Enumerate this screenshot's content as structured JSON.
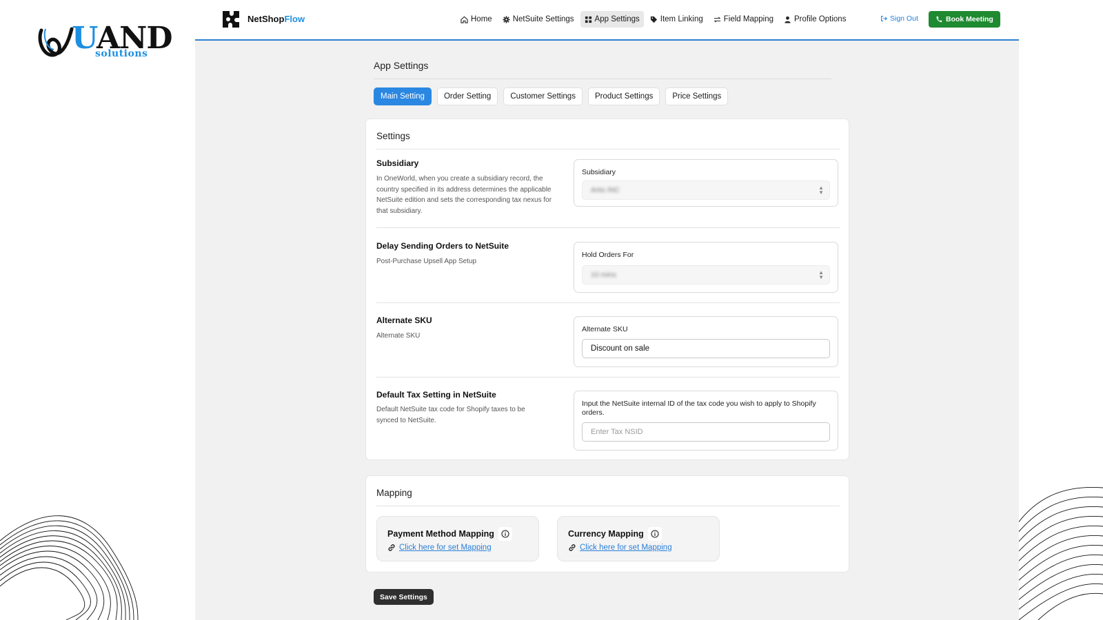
{
  "brand": {
    "name_main": "AND",
    "name_u": "U",
    "sub": "solutions"
  },
  "app": {
    "logo": {
      "name_a": "NetShop",
      "name_b": "Flow"
    },
    "nav": [
      {
        "label": "Home",
        "icon": "home-icon"
      },
      {
        "label": "NetSuite Settings",
        "icon": "gear-icon"
      },
      {
        "label": "App Settings",
        "icon": "grid-icon",
        "active": true
      },
      {
        "label": "Item Linking",
        "icon": "tag-icon"
      },
      {
        "label": "Field Mapping",
        "icon": "arrows-icon"
      },
      {
        "label": "Profile Options",
        "icon": "user-icon"
      }
    ],
    "signout": "Sign Out",
    "book": "Book Meeting"
  },
  "page": {
    "title": "App Settings",
    "tabs": [
      "Main Setting",
      "Order Setting",
      "Customer Settings",
      "Product Settings",
      "Price Settings"
    ],
    "active_tab": "Main Setting"
  },
  "settings": {
    "title": "Settings",
    "subsidiary": {
      "label": "Subsidiary",
      "desc": "In OneWorld, when you create a subsidiary record, the country specified in its address determines the applicable NetSuite edition and sets the corresponding tax nexus for that subsidiary.",
      "field_label": "Subsidiary",
      "value": "Artis INC"
    },
    "delay": {
      "label": "Delay Sending Orders to NetSuite",
      "desc": "Post-Purchase Upsell App Setup",
      "field_label": "Hold Orders For",
      "value": "10 mins"
    },
    "alt_sku": {
      "label": "Alternate SKU",
      "desc": "Alternate SKU",
      "field_label": "Alternate SKU",
      "value": "Discount on sale"
    },
    "tax": {
      "label": "Default Tax Setting in NetSuite",
      "desc": "Default NetSuite tax code for Shopify taxes to be synced to NetSuite.",
      "field_label": "Input the NetSuite internal ID of the tax code you wish to apply to Shopify orders.",
      "placeholder": "Enter Tax NSID"
    }
  },
  "mapping": {
    "title": "Mapping",
    "payment": {
      "title": "Payment Method Mapping",
      "link": "Click here for set Mapping"
    },
    "currency": {
      "title": "Currency Mapping",
      "link": "Click here for set Mapping"
    }
  },
  "save_label": "Save Settings",
  "colors": {
    "accent": "#2a87e2",
    "book": "#1e8a31",
    "link": "#2a7fd8",
    "nav_rule": "#2d7fd3"
  }
}
